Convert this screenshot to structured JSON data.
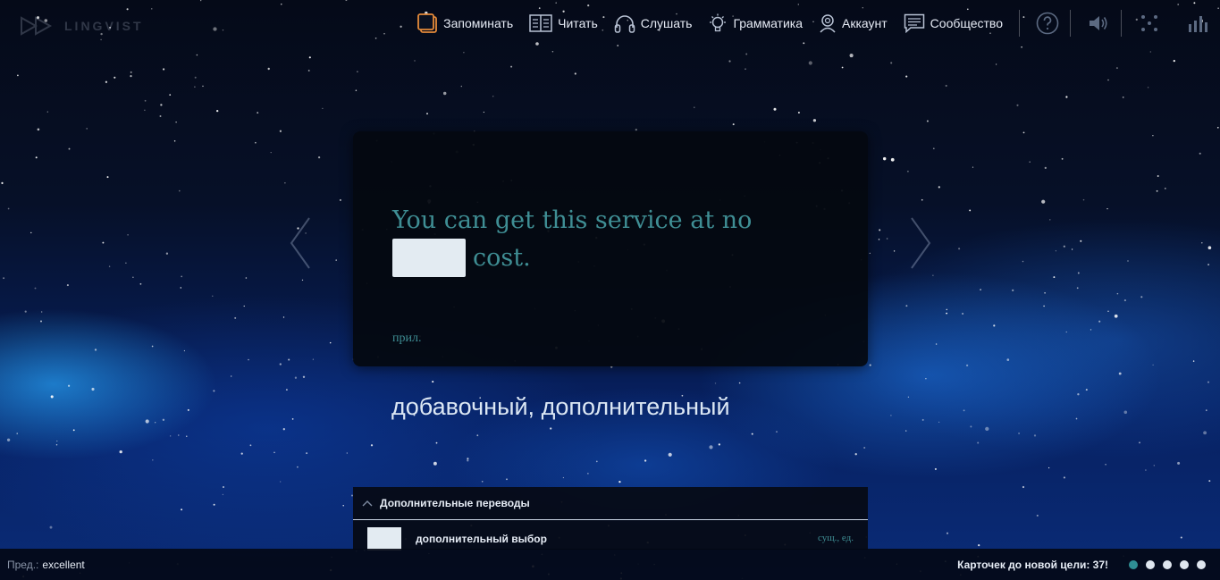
{
  "app": {
    "logo_text": "LINGVIST"
  },
  "nav": {
    "items": [
      {
        "label": "Запоминать",
        "icon": "cards-icon",
        "active": true
      },
      {
        "label": "Читать",
        "icon": "book-icon"
      },
      {
        "label": "Слушать",
        "icon": "headphones-icon"
      },
      {
        "label": "Грамматика",
        "icon": "lightbulb-icon"
      },
      {
        "label": "Аккаунт",
        "icon": "user-icon"
      },
      {
        "label": "Сообщество",
        "icon": "chat-icon"
      }
    ],
    "tools": [
      "help-icon",
      "speaker-icon",
      "fullscreen-icon",
      "stats-icon"
    ]
  },
  "card": {
    "sentence_before": "You can get this service at no",
    "sentence_after": "cost.",
    "part_of_speech": "прил.",
    "translation": "добавочный, дополнительный"
  },
  "extra": {
    "title": "Дополнительные переводы",
    "rows": [
      {
        "word": "дополнительный выбор",
        "pos": "сущ., ед."
      }
    ]
  },
  "footer": {
    "prev_label": "Пред.:",
    "prev_word": "excellent",
    "goal_text": "Карточек до новой цели: 37!",
    "dots_total": 5,
    "dots_active": 1
  },
  "colors": {
    "accent": "#e58a3a",
    "teal": "#3f8e94",
    "card_bg": "#04080f",
    "blank": "#e3ebf2"
  }
}
